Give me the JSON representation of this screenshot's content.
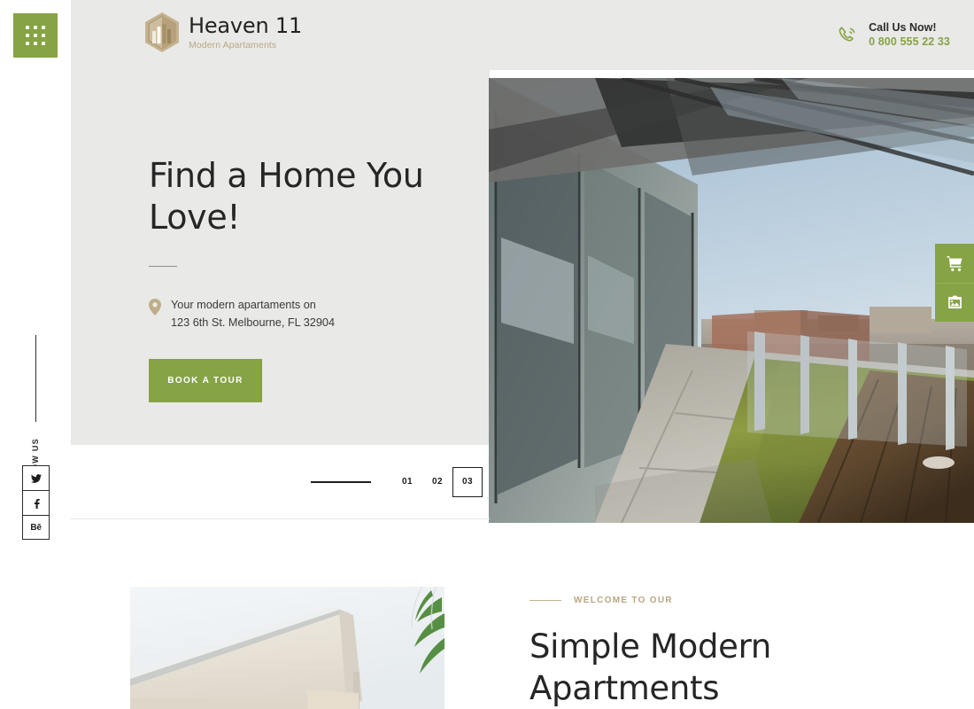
{
  "brand": {
    "name": "Heaven 11",
    "tagline": "Modern Apartaments",
    "logo_icon": "hexagon-building-icon",
    "accent_green": "#86a345",
    "accent_tan": "#b9a885"
  },
  "leftbar": {
    "menu_icon": "grid-dots-menu-icon",
    "follow_label": "FOLLOW US",
    "socials": [
      {
        "name": "twitter",
        "icon": "twitter-icon",
        "glyph": ""
      },
      {
        "name": "facebook",
        "icon": "facebook-icon",
        "glyph": "f"
      },
      {
        "name": "behance",
        "icon": "behance-icon",
        "glyph": "Bē"
      }
    ]
  },
  "header": {
    "call_icon": "phone-call-icon",
    "call_title": "Call Us Now!",
    "call_number": "0 800 555 22 33"
  },
  "hero": {
    "title": "Find a Home You Love!",
    "pin_icon": "location-pin-icon",
    "address_line1": "Your modern apartaments on",
    "address_line2": "123 6th St. Melbourne, FL 32904",
    "cta_label": "Book a Tour",
    "image_alt": "rooftop-terrace-balcony-photo"
  },
  "slider": {
    "pages": [
      {
        "label": "01",
        "active": false
      },
      {
        "label": "02",
        "active": false
      },
      {
        "label": "03",
        "active": true
      }
    ]
  },
  "side_actions": [
    {
      "name": "cart-button",
      "icon": "shopping-cart-icon"
    },
    {
      "name": "gallery-button",
      "icon": "image-gallery-icon"
    }
  ],
  "lower": {
    "eyebrow": "Welcome to our",
    "title": "Simple Modern Apartments",
    "image_alt": "white-modern-roofline-photo"
  }
}
